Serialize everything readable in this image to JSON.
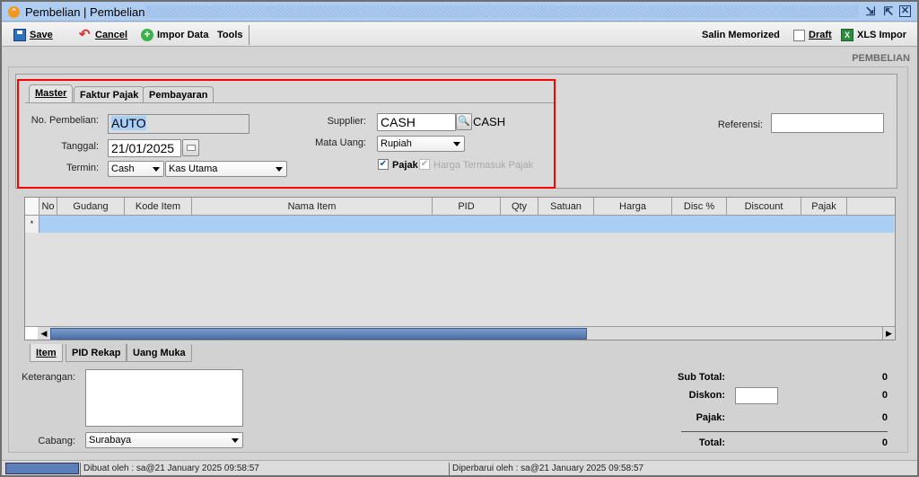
{
  "window": {
    "title": "Pembelian | Pembelian",
    "controls": [
      "restore",
      "maximize",
      "close"
    ]
  },
  "toolbar": {
    "save_label": "Save",
    "cancel_label": "Cancel",
    "import_label": "Impor Data",
    "tools_label": "Tools",
    "salin_label": "Salin Memorized",
    "draft_label": "Draft",
    "draft_checked": false,
    "xls_label": "XLS Impor"
  },
  "page_label": "PEMBELIAN",
  "tabs": [
    {
      "label": "Master",
      "active": true
    },
    {
      "label": "Faktur Pajak",
      "active": false
    },
    {
      "label": "Pembayaran",
      "active": false
    }
  ],
  "form": {
    "no_pembelian_label": "No. Pembelian:",
    "no_pembelian_value": "AUTO",
    "tanggal_label": "Tanggal:",
    "tanggal_value": "21/01/2025",
    "termin_label": "Termin:",
    "termin_value": "Cash",
    "kas_value": "Kas Utama",
    "supplier_label": "Supplier:",
    "supplier_value": "CASH",
    "supplier_name": "CASH",
    "mata_uang_label": "Mata Uang:",
    "mata_uang_value": "Rupiah",
    "pajak_label": "Pajak",
    "pajak_checked": true,
    "harga_termasuk_label": "Harga Termasuk Pajak",
    "harga_termasuk_checked": true,
    "referensi_label": "Referensi:",
    "referensi_value": ""
  },
  "grid": {
    "columns": [
      "No",
      "Gudang",
      "Kode Item",
      "Nama Item",
      "PID",
      "Qty",
      "Satuan",
      "Harga",
      "Disc %",
      "Discount",
      "Pajak",
      ""
    ],
    "new_row_marker": "*",
    "rows": []
  },
  "bottom_tabs": [
    {
      "label": "Item",
      "active": true
    },
    {
      "label": "PID Rekap",
      "active": false
    },
    {
      "label": "Uang Muka",
      "active": false
    }
  ],
  "footer": {
    "keterangan_label": "Keterangan:",
    "keterangan_value": "",
    "cabang_label": "Cabang:",
    "cabang_value": "Surabaya",
    "subtotal_label": "Sub Total:",
    "subtotal_value": "0",
    "diskon_label": "Diskon:",
    "diskon_input": "",
    "diskon_value": "0",
    "pajak_label": "Pajak:",
    "pajak_value": "0",
    "total_label": "Total:",
    "total_value": "0"
  },
  "status": {
    "created": "Dibuat oleh : sa@21 January 2025  09:58:57",
    "updated": "Diperbarui oleh : sa@21 January 2025  09:58:57"
  }
}
